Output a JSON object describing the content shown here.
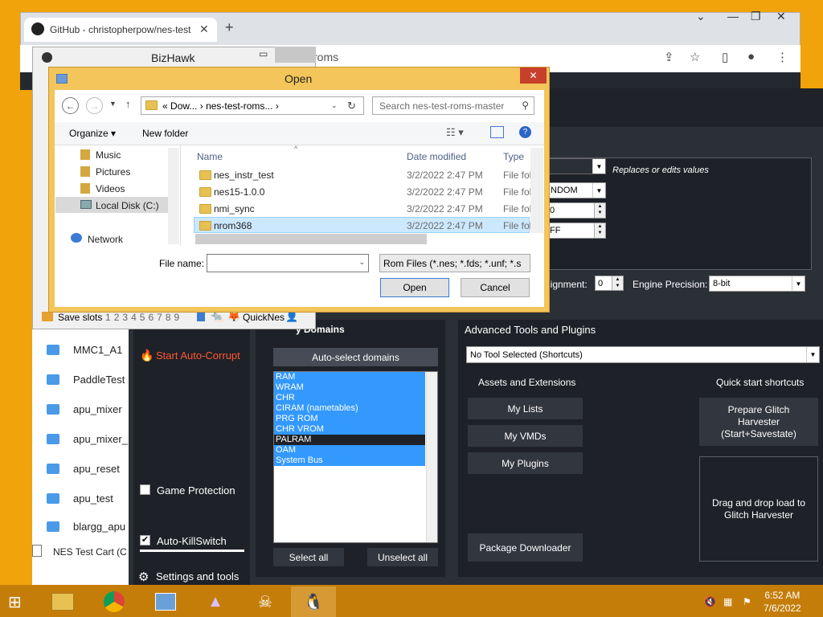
{
  "chrome": {
    "tab_title": "GitHub - christopherpow/nes-test",
    "omnibox_fragment": "roms",
    "tab_close": "✕",
    "new_tab": "+"
  },
  "bizhawk": {
    "title": "BizHawk",
    "save_slots_label": "Save slots",
    "slots": [
      "1",
      "2",
      "3",
      "4",
      "5",
      "6",
      "7",
      "8",
      "9"
    ],
    "core": "QuickNes"
  },
  "open_dialog": {
    "title": "Open",
    "breadcrumb": [
      "«",
      "Dow...",
      "›",
      "nes-test-roms...",
      "›"
    ],
    "search_placeholder": "Search nes-test-roms-master",
    "organize": "Organize",
    "new_folder": "New folder",
    "nav_items": [
      "Music",
      "Pictures",
      "Videos",
      "Local Disk (C:)",
      "Network"
    ],
    "columns": [
      "Name",
      "Date modified",
      "Type"
    ],
    "files": [
      {
        "name": "nes_instr_test",
        "date": "3/2/2022 2:47 PM",
        "type": "File fol"
      },
      {
        "name": "nes15-1.0.0",
        "date": "3/2/2022 2:47 PM",
        "type": "File fol"
      },
      {
        "name": "nmi_sync",
        "date": "3/2/2022 2:47 PM",
        "type": "File fol"
      },
      {
        "name": "nrom368",
        "date": "3/2/2022 2:47 PM",
        "type": "File fol"
      }
    ],
    "file_name_label": "File name:",
    "file_name_value": "",
    "filter": "Rom Files (*.nes; *.fds; *.unf; *.s",
    "open_btn": "Open",
    "cancel_btn": "Cancel"
  },
  "explorer": {
    "items": [
      "MMC1_A1",
      "PaddleTest",
      "apu_mixer",
      "apu_mixer_",
      "apu_reset",
      "apu_test",
      "blargg_apu"
    ],
    "bottom_item": "NES Test Cart (C"
  },
  "rtc": {
    "replaces_hint": "Replaces or edits values",
    "random_value": "NDOM",
    "spin1_value": "0",
    "spin2_value": "FF",
    "alignment_label": "lignment:",
    "alignment_value": "0",
    "engine_precision_label": "Engine Precision:",
    "engine_precision_value": "8-bit",
    "memory_domains_title": "y Domains",
    "start_autocorrupt": "Start Auto-Corrupt",
    "auto_select_domains": "Auto-select domains",
    "domains": [
      {
        "name": "RAM",
        "selected": true
      },
      {
        "name": "WRAM",
        "selected": true
      },
      {
        "name": "CHR",
        "selected": true
      },
      {
        "name": "CIRAM (nametables)",
        "selected": true
      },
      {
        "name": "PRG ROM",
        "selected": true
      },
      {
        "name": "CHR VROM",
        "selected": true
      },
      {
        "name": "PALRAM",
        "selected": false
      },
      {
        "name": "OAM",
        "selected": true
      },
      {
        "name": "System Bus",
        "selected": true
      }
    ],
    "select_all": "Select all",
    "unselect_all": "Unselect all",
    "game_protection": "Game Protection",
    "auto_killswitch": "Auto-KillSwitch",
    "settings_and_tools": "Settings and tools",
    "advanced_title": "Advanced Tools and Plugins",
    "tool_select": "No Tool Selected (Shortcuts)",
    "assets_title": "Assets and Extensions",
    "my_lists": "My Lists",
    "my_vmds": "My VMDs",
    "my_plugins": "My Plugins",
    "package_downloader": "Package Downloader",
    "quick_start_title": "Quick start shortcuts",
    "prepare_gh": "Prepare Glitch Harvester (Start+Savestate)",
    "drag_drop": "Drag and drop load to Glitch Harvester"
  },
  "taskbar": {
    "time": "6:52 AM",
    "date": "7/6/2022"
  },
  "colors": {
    "desktop": "#f0a30a",
    "taskbar": "#c57d0a",
    "rtc_bg": "#2b2f36",
    "selection_blue": "#3399ff",
    "accent_red": "#ff5533"
  }
}
